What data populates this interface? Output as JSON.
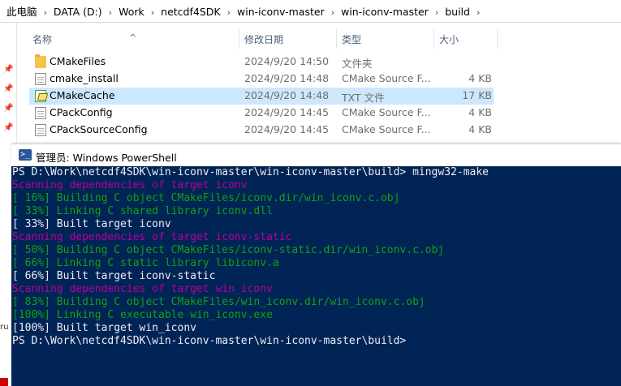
{
  "explorer": {
    "breadcrumb": [
      "此电脑",
      "DATA (D:)",
      "Work",
      "netcdf4SDK",
      "win-iconv-master",
      "win-iconv-master",
      "build"
    ],
    "columns": {
      "name": "名称",
      "date": "修改日期",
      "type": "类型",
      "size": "大小"
    },
    "files": [
      {
        "name": "CMakeFiles",
        "date": "2024/9/20 14:50",
        "type": "文件夹",
        "size": "",
        "icon": "folder-icon"
      },
      {
        "name": "cmake_install",
        "date": "2024/9/20 14:48",
        "type": "CMake Source F...",
        "size": "4 KB",
        "icon": "document-icon"
      },
      {
        "name": "CMakeCache",
        "date": "2024/9/20 14:48",
        "type": "TXT 文件",
        "size": "17 KB",
        "icon": "text-file-icon"
      },
      {
        "name": "CPackConfig",
        "date": "2024/9/20 14:45",
        "type": "CMake Source F...",
        "size": "4 KB",
        "icon": "document-icon"
      },
      {
        "name": "CPackSourceConfig",
        "date": "2024/9/20 14:45",
        "type": "CMake Source F...",
        "size": "4 KB",
        "icon": "document-icon"
      }
    ],
    "left_pane_text": "ru"
  },
  "powershell": {
    "title": "管理员: Windows PowerShell",
    "lines": [
      {
        "text": "PS D:\\Work\\netcdf4SDK\\win-iconv-master\\win-iconv-master\\build> mingw32-make",
        "color": "white"
      },
      {
        "text": "Scanning dependencies of target iconv",
        "color": "magenta"
      },
      {
        "text": "[ 16%] Building C object CMakeFiles/iconv.dir/win_iconv.c.obj",
        "color": "green"
      },
      {
        "text": "[ 33%] Linking C shared library iconv.dll",
        "color": "green"
      },
      {
        "text": "[ 33%] Built target iconv",
        "color": "white"
      },
      {
        "text": "Scanning dependencies of target iconv-static",
        "color": "magenta"
      },
      {
        "text": "[ 50%] Building C object CMakeFiles/iconv-static.dir/win_iconv.c.obj",
        "color": "green"
      },
      {
        "text": "[ 66%] Linking C static library libiconv.a",
        "color": "green"
      },
      {
        "text": "[ 66%] Built target iconv-static",
        "color": "white"
      },
      {
        "text": "Scanning dependencies of target win_iconv",
        "color": "magenta"
      },
      {
        "text": "[ 83%] Building C object CMakeFiles/win_iconv.dir/win_iconv.c.obj",
        "color": "green"
      },
      {
        "text": "[100%] Linking C executable win_iconv.exe",
        "color": "green"
      },
      {
        "text": "[100%] Built target win_iconv",
        "color": "white"
      },
      {
        "text": "PS D:\\Work\\netcdf4SDK\\win-iconv-master\\win-iconv-master\\build>",
        "color": "white"
      }
    ],
    "colors": {
      "background": "#012456",
      "white": "#eeedf0",
      "magenta": "#b5009e",
      "green": "#13a10e"
    }
  }
}
